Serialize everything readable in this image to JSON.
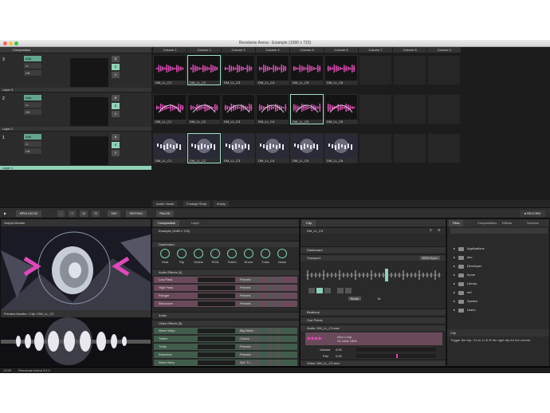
{
  "window": {
    "title": "Resolume Arena - Example (1080 x 720)"
  },
  "layers": {
    "header": "Composition",
    "blend_labels": [
      "Add",
      "Lt",
      "Lift"
    ],
    "ctl": [
      "B",
      "S",
      "X"
    ],
    "items": [
      {
        "num": "3",
        "name": "Layer 3"
      },
      {
        "num": "2",
        "name": "Layer 2"
      },
      {
        "num": "1",
        "name": "Layer 1"
      }
    ]
  },
  "columns": [
    "Column 1",
    "Column 2",
    "Column 3",
    "Column 4",
    "Column 5",
    "Column 6",
    "Column 7",
    "Column 8",
    "Column 9"
  ],
  "clip_rows": [
    [
      "DM_LL_C1",
      "DM_LL_C2",
      "DM_LL_C3",
      "DM_LL_C4",
      "DM_LL_C5",
      "DM_LL_C6"
    ],
    [
      "DM_LL_C1",
      "DM_LL_C2",
      "DM_LL_C3",
      "DM_LL_C4",
      "DM_LL_C5",
      "DM_LL_C6"
    ],
    [
      "DM_LL_C1",
      "DM_LL_C2",
      "DM_LL_C3",
      "DM_LL_C4",
      "DM_LL_C5",
      "DM_LL_C6"
    ]
  ],
  "decks": [
    "Audio Visual",
    "Footage Shop",
    "empty"
  ],
  "bar": {
    "bpm": "BPM 120.00",
    "minus": "-",
    "plus": "+",
    "half": "/2",
    "double": "*2",
    "tap": "TAP",
    "resync": "RESYNC",
    "pause": "PAUSE",
    "record": "RECORD"
  },
  "output": {
    "title": "Output Monitor",
    "preview_title": "Preview Monitor / Clip / DM_LL_C3"
  },
  "composition_panel": {
    "tabs": [
      "Composition",
      "Layer"
    ],
    "name": "Example (1080 x 720)",
    "dashboard": "Dashboard",
    "knobs": [
      "Heat",
      "Flip",
      "Strobe",
      "RGB",
      "Twitch",
      "Drone",
      "Trails",
      "Noise"
    ],
    "audio_fx": "Audio Effects (4)",
    "audio_rows": [
      "Low Pass",
      "High Pass",
      "Flanger",
      "Bitcrusher"
    ],
    "presets": "Presets",
    "audio": "Audio",
    "video_fx": "Video Effects (8)",
    "video_rows": [
      {
        "name": "Wave Warp",
        "preset": "Big Wave"
      },
      {
        "name": "Twitch",
        "preset": "Chaos"
      },
      {
        "name": "Trails",
        "preset": "Presets"
      },
      {
        "name": "Distortion",
        "preset": "Presets"
      },
      {
        "name": "Ward Warp",
        "preset": "Set. Tr..."
      },
      {
        "name": "Shift RGB",
        "preset": "Jet Good"
      },
      {
        "name": "Hue rotate",
        "preset": "Presets"
      }
    ]
  },
  "clip_panel": {
    "tab": "Clip",
    "name": "DM_LL_C3",
    "dashboard": "Dashboard",
    "transport": "Transport",
    "bpm_sync": "BPM Sync",
    "beats": "Beats",
    "beat_count": "16",
    "beatloop": "Beatloop",
    "cue_points": "Cue Points",
    "audio_file": "Audio: DM_LL_C3.wav",
    "audio_info": "Intro Loop\n44.1kHz 16bit",
    "volume_label": "Volume",
    "volume_val": "0.00",
    "pan_label": "Pan",
    "pan_val": "0.00",
    "video_file": "Video: DM_LL_C3.mov",
    "video_info": "1080 x 720 Apple ProRes\n25.00 fps 00:08"
  },
  "files_panel": {
    "tabs": [
      "Files",
      "Compositions",
      "Effects",
      "Sources"
    ],
    "items": [
      "Applications",
      "dev",
      "Developer",
      "home",
      "Library",
      "net",
      "System",
      "Users"
    ]
  },
  "clip_help": {
    "title": "Clip",
    "text": "Trigger the clip. Go to 1/ 4/ 8/ the right clip for the current"
  },
  "status": {
    "time": "13:59",
    "version": "Resolume Arena 5.0.0"
  },
  "colors": {
    "accent": "#8fd1b6",
    "pink": "#d466a6",
    "bg": "#262626"
  }
}
